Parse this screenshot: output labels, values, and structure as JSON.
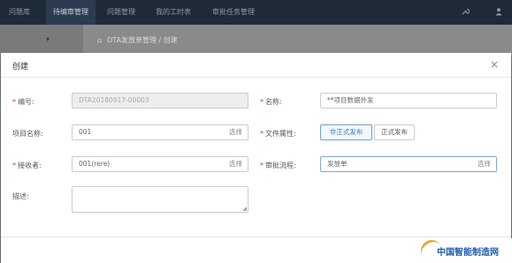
{
  "topnav": {
    "items": [
      "问题库",
      "待编审管理",
      "问题管理",
      "我的工时表",
      "审批任务管理"
    ],
    "active_index": 1,
    "icons": [
      "wrench-icon",
      "user-icon"
    ]
  },
  "subbar": {
    "caret": "▾",
    "home_icon": "home-icon",
    "breadcrumb": "DTA发放单管理 / 创建"
  },
  "modal": {
    "title": "创建",
    "close": "×",
    "fields": {
      "code": {
        "label": "编号:",
        "value": "DTA20180917-00003",
        "required": true
      },
      "name": {
        "label": "名称:",
        "value": "**项目数据外发",
        "required": true
      },
      "project": {
        "label": "项目名称:",
        "value": "001",
        "pick": "选择",
        "required": false
      },
      "file_attr": {
        "label": "文件属性:",
        "options": [
          "非正式发布",
          "正式发布"
        ],
        "selected": 0,
        "required": true
      },
      "receiver": {
        "label": "接收者:",
        "value": "001(rere)",
        "pick": "选择",
        "required": true
      },
      "approval": {
        "label": "审批流程:",
        "value": "发放单",
        "pick": "选择",
        "required": true
      },
      "desc": {
        "label": "描述:",
        "value": "",
        "required": false
      }
    },
    "required_mark": "*"
  },
  "watermark": {
    "text": "中国智能制造网"
  },
  "colors": {
    "nav_bg": "#1f2a38",
    "accent": "#3a78c3",
    "required": "#dd3333",
    "watermark": "#1d5fb0"
  }
}
